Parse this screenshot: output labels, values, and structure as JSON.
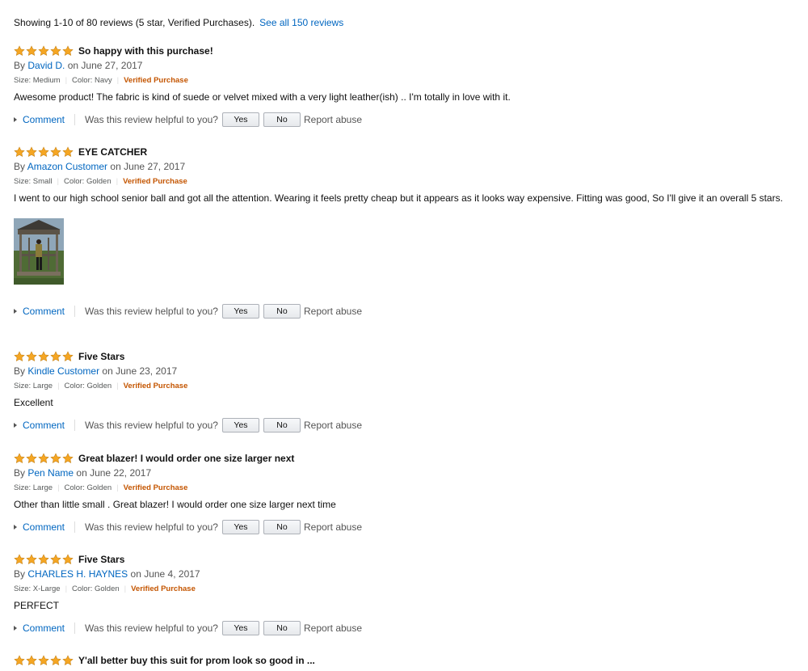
{
  "summary": {
    "text": "Showing 1-10 of 80 reviews (5 star, Verified Purchases).",
    "see_all": "See all 150 reviews"
  },
  "star_color": "#f5a623",
  "common": {
    "by": "By",
    "comment": "Comment",
    "helpful_question": "Was this review helpful to you?",
    "yes": "Yes",
    "no": "No",
    "report": "Report abuse",
    "verified": "Verified Purchase"
  },
  "reviews": [
    {
      "rating": 5,
      "title": "So happy with this purchase!",
      "author": "David D.",
      "date": "on June 27, 2017",
      "size": "Size: Medium",
      "color": "Color: Navy",
      "body": "Awesome product! The fabric is kind of suede or velvet mixed with a very light leather(ish) .. I'm totally in love with it."
    },
    {
      "rating": 5,
      "title": "EYE CATCHER",
      "author": "Amazon Customer",
      "date": "on June 27, 2017",
      "size": "Size: Small",
      "color": "Color: Golden",
      "body": "I went to our high school senior ball and got all the attention. Wearing it feels pretty cheap but it appears as it looks way expensive. Fitting was good, So I'll give it an overall 5 stars."
    },
    {
      "rating": 5,
      "title": "Five Stars",
      "author": "Kindle Customer",
      "date": "on June 23, 2017",
      "size": "Size: Large",
      "color": "Color: Golden",
      "body": "Excellent"
    },
    {
      "rating": 5,
      "title": "Great blazer! I would order one size larger next",
      "author": "Pen Name",
      "date": "on June 22, 2017",
      "size": "Size: Large",
      "color": "Color: Golden",
      "body": "Other than little small . Great blazer! I would order one size larger next time"
    },
    {
      "rating": 5,
      "title": "Five Stars",
      "author": "CHARLES H. HAYNES",
      "date": "on June 4, 2017",
      "size": "Size: X-Large",
      "color": "Color: Golden",
      "body": "PERFECT"
    },
    {
      "rating": 5,
      "title": "Y'all better buy this suit for prom look so good in ..."
    }
  ]
}
